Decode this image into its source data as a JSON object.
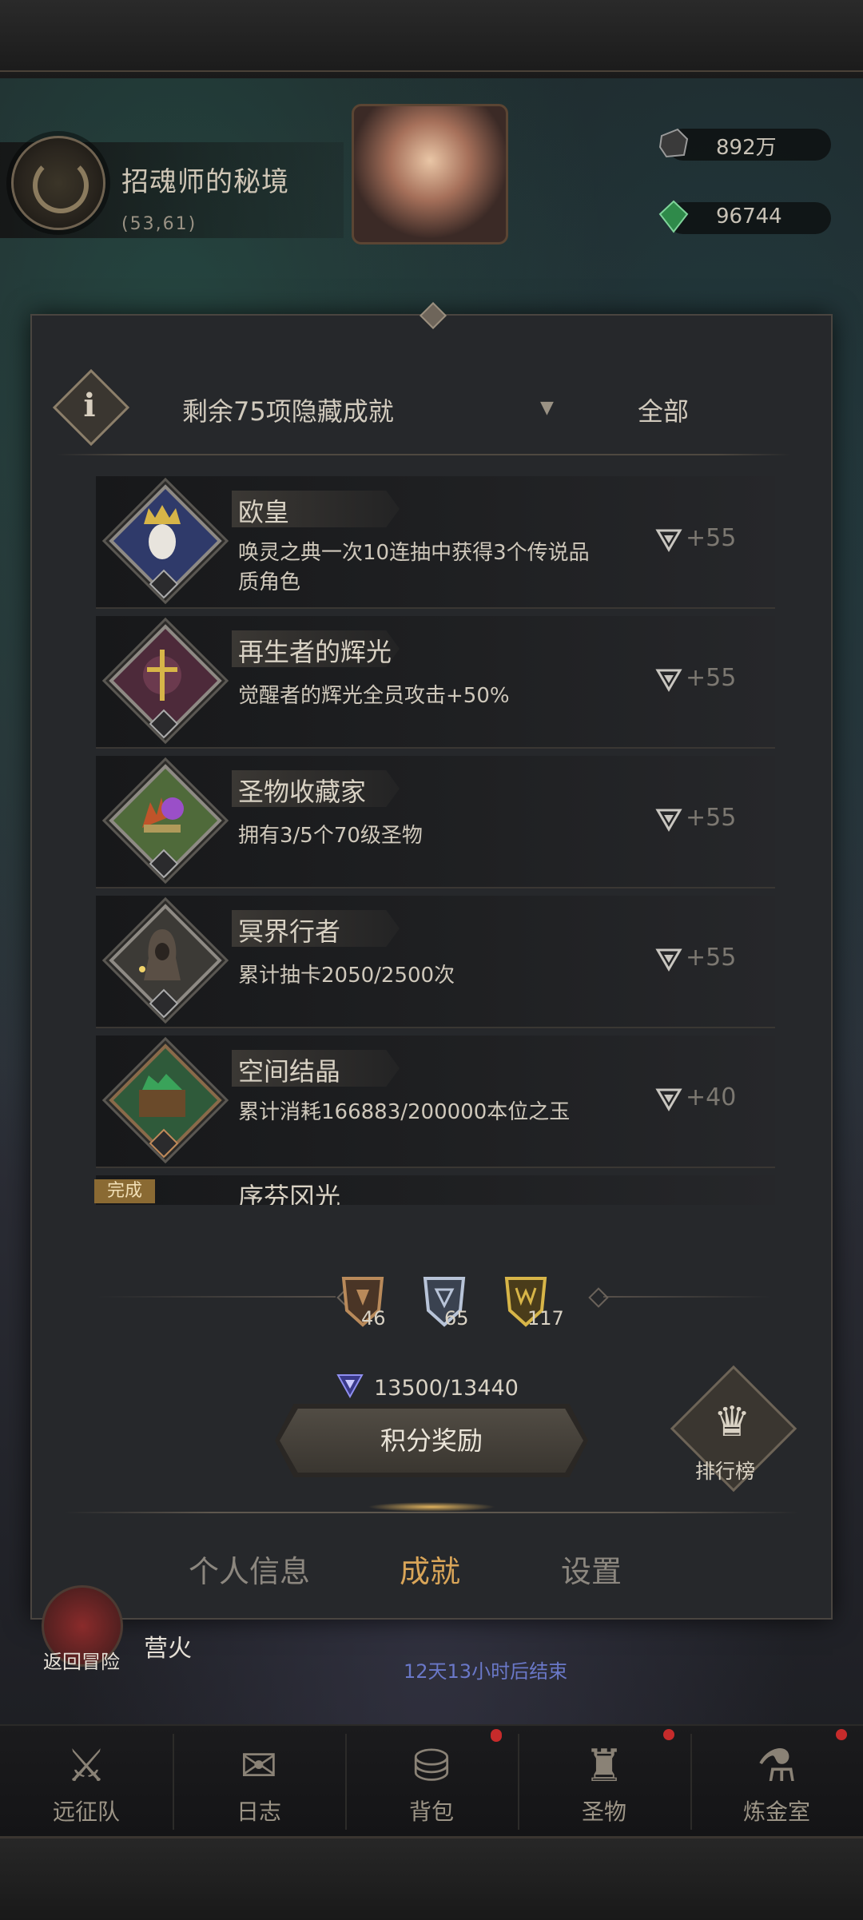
{
  "realm": {
    "title": "招魂师的秘境",
    "coords": "(53,61)"
  },
  "currency": [
    {
      "name": "stone",
      "value": "892万",
      "color": "#cfcfcf"
    },
    {
      "name": "gem",
      "value": "96744",
      "color": "#3fa35a"
    }
  ],
  "header": {
    "hidden_text": "剩余75项隐藏成就",
    "filter_label": "全部"
  },
  "achievements": [
    {
      "title": "欧皇",
      "desc": "唤灵之典一次10连抽中获得3个传说品质角色",
      "points": "+55",
      "tier": "silver",
      "color": "#2f3a6a"
    },
    {
      "title": "再生者的辉光",
      "desc": "觉醒者的辉光全员攻击+50%",
      "points": "+55",
      "tier": "silver",
      "color": "#4d2a3a"
    },
    {
      "title": "圣物收藏家",
      "desc": "拥有3/5个70级圣物",
      "points": "+55",
      "tier": "silver",
      "color": "#4f6a3a"
    },
    {
      "title": "冥界行者",
      "desc": "累计抽卡2050/2500次",
      "points": "+55",
      "tier": "silver",
      "color": "#3c3a36"
    },
    {
      "title": "空间结晶",
      "desc": "累计消耗166883/200000本位之玉",
      "points": "+40",
      "tier": "bronze",
      "color": "#2f5a3a"
    }
  ],
  "partial_row": {
    "completed_label": "完成",
    "title": "序芬冈光"
  },
  "medals": [
    {
      "tier": "bronze",
      "count": "46",
      "color": "#b98a5a"
    },
    {
      "tier": "silver",
      "count": "65",
      "color": "#b8c4d8"
    },
    {
      "tier": "gold",
      "count": "117",
      "color": "#d7b548"
    }
  ],
  "points": {
    "text": "13500/13440",
    "icon": "triangle-gem-icon"
  },
  "buttons": {
    "reward": "积分奖励",
    "ranking": "排行榜"
  },
  "tabs": [
    {
      "label": "个人信息",
      "active": false
    },
    {
      "label": "成就",
      "active": true
    },
    {
      "label": "设置",
      "active": false
    }
  ],
  "below": {
    "back": "返回冒险",
    "camp": "营火",
    "timer": "12天13小时后结束"
  },
  "nav": [
    {
      "label": "远征队",
      "icon": "helmet-icon",
      "dot": false
    },
    {
      "label": "日志",
      "icon": "journal-icon",
      "dot": true
    },
    {
      "label": "背包",
      "icon": "backpack-icon",
      "dot": true
    },
    {
      "label": "圣物",
      "icon": "relic-icon",
      "dot": true
    },
    {
      "label": "炼金室",
      "icon": "alchemy-icon",
      "dot": true
    }
  ],
  "colors": {
    "accent": "#d9a558",
    "panel": "#26282b",
    "notification": "#c62b2b"
  }
}
